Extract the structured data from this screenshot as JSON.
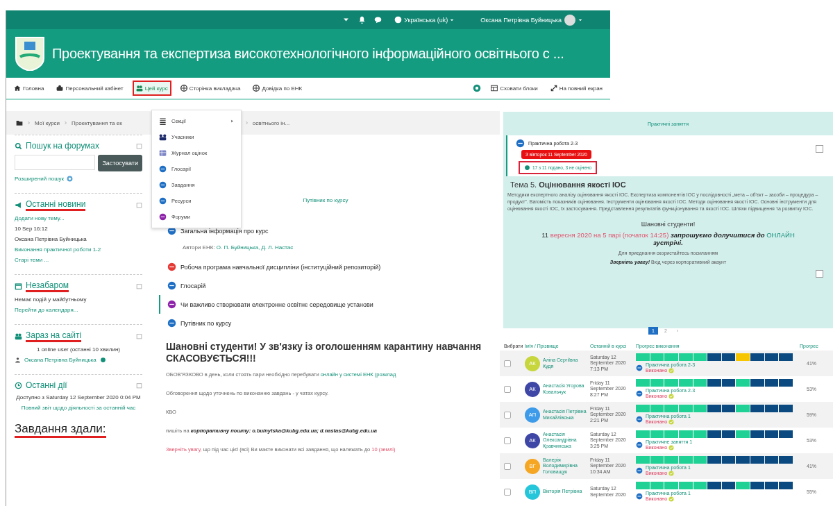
{
  "top_bar": {
    "language": "Українська (uk)",
    "user": "Оксана Петрівна Буйницька"
  },
  "header": {
    "title": "Проектування та експертиза високотехнологічного інформаційного освітнього с ..."
  },
  "nav": {
    "items": [
      {
        "label": "Головна",
        "highlighted": false
      },
      {
        "label": "Персональний кабінет",
        "highlighted": false
      },
      {
        "label": "Цей курс",
        "highlighted": true
      },
      {
        "label": "Сторінка викладача",
        "highlighted": false
      },
      {
        "label": "Довідка по ЕНК",
        "highlighted": false
      }
    ],
    "right": [
      {
        "label": "Сховати блоки"
      },
      {
        "label": "На повний екран"
      }
    ]
  },
  "breadcrumb": [
    "Мої курси",
    "Проектування та ек",
    "освітнього ін..."
  ],
  "dropdown": {
    "items": [
      {
        "kind": "list",
        "label": "Секції",
        "has_submenu": true
      },
      {
        "kind": "people",
        "label": "Учасники",
        "has_submenu": false
      },
      {
        "kind": "grades",
        "label": "Журнал оцінок",
        "has_submenu": false
      },
      {
        "kind": "activity",
        "label": "Глосарії",
        "color": "#1f6fc5",
        "has_submenu": false
      },
      {
        "kind": "activity",
        "label": "Завдання",
        "color": "#1f6fc5",
        "has_submenu": false
      },
      {
        "kind": "activity",
        "label": "Ресурси",
        "color": "#1f6fc5",
        "has_submenu": false
      },
      {
        "kind": "activity",
        "label": "Форуми",
        "color": "#8e24aa",
        "has_submenu": false
      }
    ]
  },
  "sidebar": {
    "blocks": [
      {
        "kind": "search",
        "title": "Пошук на форумах",
        "underlined": false,
        "button": "Застосувати",
        "link": "Розширений пошук"
      },
      {
        "kind": "list",
        "title": "Останні новини",
        "underlined": true,
        "lines": [
          {
            "text": "Додати нову тему...",
            "kind": "link"
          },
          {
            "text": "10 Sep 16:12",
            "kind": "text"
          },
          {
            "text": "Оксана Петрівна Буйницька",
            "kind": "text"
          },
          {
            "text": "Виконання практичної роботи 1-2",
            "kind": "link"
          },
          {
            "text": "Старі теми ...",
            "kind": "link"
          }
        ]
      },
      {
        "kind": "list",
        "title": "Незабаром",
        "underlined": true,
        "lines": [
          {
            "text": "Немає подій у майбутньому",
            "kind": "text"
          },
          {
            "text": "Перейти до календаря...",
            "kind": "link"
          }
        ]
      },
      {
        "kind": "list",
        "title": "Зараз на сайті",
        "underlined": true,
        "lines": [
          {
            "text": "1 online user (останні 10 хвилин)",
            "kind": "center"
          },
          {
            "text": "Оксана Петрівна Буйницька",
            "kind": "user"
          }
        ]
      },
      {
        "kind": "list",
        "title": "Останні дії",
        "underlined": false,
        "lines": [
          {
            "text": "Доступно з Saturday 12 September 2020 0:04 PM",
            "kind": "center"
          },
          {
            "text": "Повний звіт щодо діяльності за останній час",
            "kind": "centerlink"
          }
        ]
      }
    ],
    "note": {
      "text": "Завдання здали:",
      "underlined": true
    }
  },
  "course": {
    "guide_link": "Путівник по курсу",
    "items": [
      {
        "kind": "activity",
        "title": "Загальна інформація про курс",
        "color": "#1f6fc5",
        "current": false
      },
      {
        "kind": "note",
        "text": "Автори ЕНК:",
        "link": "О. П. Буйницька, Д. Л. Настас"
      },
      {
        "kind": "activity",
        "title": "Робоча програма навчальної дисципліни (інституційний репозиторій)",
        "color": "#e53935",
        "current": false
      },
      {
        "kind": "activity",
        "title": "Глосарій",
        "color": "#1f6fc5",
        "current": false
      },
      {
        "kind": "activity",
        "title": "Чи важливо створювати електронне освітнє середовище установи",
        "color": "#8e24aa",
        "current": true
      },
      {
        "kind": "activity",
        "title": "Путівник по курсу",
        "color": "#1f6fc5",
        "current": false
      }
    ],
    "announcement": {
      "heading": "Шановні студенти! У зв'язку із оголошенням карантину навчання СКАСОВУЄТЬСЯ!!!",
      "paragraphs": [
        [
          {
            "kind": "plain",
            "text": "ОБОВ'ЯЗКОВО в день, коли стоять пари необхідно перебувати"
          },
          {
            "kind": "link",
            "text": "онлайн у системі ЕНК (розклад"
          }
        ],
        [
          {
            "kind": "plain",
            "text": "Обговорення щодо уточнень по виконанню завдань - у чатах курсу."
          }
        ],
        [
          {
            "kind": "plain",
            "text": "КВО"
          }
        ],
        [
          {
            "kind": "plain",
            "text": "пишіть на"
          },
          {
            "kind": "bold",
            "text": "корпоративну пошту: o.buinytska@kubg.edu.ua; d.nastas@kubg.edu.ua"
          }
        ],
        [
          {
            "kind": "alert",
            "text": "Зверніть увагу,"
          },
          {
            "kind": "plain",
            "text": "що під час цієї (всі) Ви маєте виконати всі завдання, що належать до"
          },
          {
            "kind": "alert",
            "text": "10 (землі)"
          }
        ]
      ]
    }
  },
  "practice": {
    "section_title": "Практичні заняття",
    "activity": {
      "title": "Практична робота 2-3",
      "deadline": "З вівторок 11 September 2020",
      "submissions": "17 з 11 подано, 3 не оцінено",
      "highlighted": true,
      "completed": false
    },
    "notice_completed": false,
    "topic": {
      "label": "Тема 5.",
      "title": "Оцінювання якості ІОС"
    },
    "description": "Методики експертного аналізу оцінювання якості ІОС. Експертиза компонентів ІОС у послідовності „мета – об'єкт – засоби – процедура – продукт\". Вагомість показників оцінювання. Інструменти оцінювання якості ІОС. Методи оцінювання якості ІОС. Основні інструменти для оцінювання якості ІОС, їх застосування. Представлення результатів функціонування та якості ІОС. Шляхи підвищення та розвитку ІОС.",
    "greeting": "Шановні студенти!",
    "invite": [
      {
        "kind": "plain",
        "text": "11"
      },
      {
        "kind": "alert",
        "text": "вересня 2020 на 5 парі (початок 14:25)"
      },
      {
        "kind": "bold",
        "text": "запрошуємо долучитися до"
      },
      {
        "kind": "link",
        "text": "ОНЛАЙН"
      },
      {
        "kind": "bold",
        "text": "зустрічі."
      }
    ],
    "join": "Для приєднання скористайтесь посиланням",
    "warning": [
      {
        "kind": "bold",
        "text": "Зверніть увагу!"
      },
      {
        "kind": "plain",
        "text": "Вхід через корпоративний акаунт"
      }
    ],
    "pages": [
      {
        "label": "1",
        "selected": true
      },
      {
        "label": "2",
        "selected": false
      },
      {
        "label": "›",
        "selected": false
      }
    ]
  },
  "progress_table": {
    "columns": [
      "Вибрати",
      "Ім'я / Прізвище",
      "Останній в курсі",
      "Прогрес виконання",
      "Прогрес"
    ],
    "rows": [
      {
        "selected": false,
        "initials": "АК",
        "color": "#c6d63c",
        "name": "Аліна Сергіївна Кудя",
        "last": "Saturday 12 September 2020 7:13 PM",
        "segments": [
          {
            "complete": true,
            "pending": false
          },
          {
            "complete": true,
            "pending": false
          },
          {
            "complete": true,
            "pending": false
          },
          {
            "complete": true,
            "pending": false
          },
          {
            "complete": true,
            "pending": false
          },
          {
            "complete": false,
            "pending": false
          },
          {
            "complete": false,
            "pending": false
          },
          {
            "complete": false,
            "pending": true
          },
          {
            "complete": false,
            "pending": false
          },
          {
            "complete": false,
            "pending": false
          },
          {
            "complete": false,
            "pending": false
          }
        ],
        "activity": "Практична робота 2-3",
        "status": "Виконано",
        "percent": "41%"
      },
      {
        "selected": false,
        "initials": "АК",
        "color": "#3f47a6",
        "name": "Анастасія Угорова Ковальчук",
        "last": "Friday 11 September 2020 8:27 PM",
        "segments": [
          {
            "complete": true,
            "pending": false
          },
          {
            "complete": true,
            "pending": false
          },
          {
            "complete": true,
            "pending": false
          },
          {
            "complete": true,
            "pending": false
          },
          {
            "complete": true,
            "pending": false
          },
          {
            "complete": false,
            "pending": false
          },
          {
            "complete": false,
            "pending": false
          },
          {
            "complete": true,
            "pending": false
          },
          {
            "complete": false,
            "pending": false
          },
          {
            "complete": false,
            "pending": false
          },
          {
            "complete": false,
            "pending": false
          }
        ],
        "activity": "Практична робота 2-3",
        "status": "Виконано",
        "percent": "53%"
      },
      {
        "selected": false,
        "initials": "АП",
        "color": "#3d9be9",
        "name": "Анастасія Петрівна Михайлівська",
        "last": "Friday 11 September 2020 2:21 PM",
        "segments": [
          {
            "complete": true,
            "pending": false
          },
          {
            "complete": true,
            "pending": false
          },
          {
            "complete": true,
            "pending": false
          },
          {
            "complete": true,
            "pending": false
          },
          {
            "complete": true,
            "pending": false
          },
          {
            "complete": false,
            "pending": false
          },
          {
            "complete": false,
            "pending": false
          },
          {
            "complete": true,
            "pending": false
          },
          {
            "complete": false,
            "pending": false
          },
          {
            "complete": false,
            "pending": false
          },
          {
            "complete": false,
            "pending": false
          }
        ],
        "activity": "Практична робота 1",
        "status": "Виконано",
        "percent": "59%"
      },
      {
        "selected": false,
        "initials": "АК",
        "color": "#3f47a6",
        "name": "Анастасія Олександрівна Кравчинська",
        "last": "Saturday 12 September 2020 3:25 PM",
        "segments": [
          {
            "complete": true,
            "pending": false
          },
          {
            "complete": true,
            "pending": false
          },
          {
            "complete": true,
            "pending": false
          },
          {
            "complete": true,
            "pending": false
          },
          {
            "complete": true,
            "pending": false
          },
          {
            "complete": false,
            "pending": false
          },
          {
            "complete": false,
            "pending": false
          },
          {
            "complete": true,
            "pending": false
          },
          {
            "complete": false,
            "pending": false
          },
          {
            "complete": false,
            "pending": false
          },
          {
            "complete": false,
            "pending": false
          }
        ],
        "activity": "Практичне заняття 1",
        "status": "Виконано",
        "percent": "53%"
      },
      {
        "selected": false,
        "initials": "ВГ",
        "color": "#f5a623",
        "name": "Валерія Володимирівна Головащук",
        "last": "Friday 11 September 2020 10:34 AM",
        "segments": [
          {
            "complete": true,
            "pending": false
          },
          {
            "complete": true,
            "pending": false
          },
          {
            "complete": true,
            "pending": false
          },
          {
            "complete": true,
            "pending": false
          },
          {
            "complete": true,
            "pending": false
          },
          {
            "complete": false,
            "pending": false
          },
          {
            "complete": false,
            "pending": false
          },
          {
            "complete": false,
            "pending": false
          },
          {
            "complete": false,
            "pending": false
          },
          {
            "complete": false,
            "pending": false
          },
          {
            "complete": false,
            "pending": false
          }
        ],
        "activity": "Практична робота 1",
        "status": "Виконано",
        "percent": "41%"
      },
      {
        "selected": false,
        "initials": "ВП",
        "color": "#26c6da",
        "name": "Вікторія Петрівна",
        "last": "Saturday 12 September 2020",
        "segments": [
          {
            "complete": true,
            "pending": false
          },
          {
            "complete": true,
            "pending": false
          },
          {
            "complete": true,
            "pending": false
          },
          {
            "complete": true,
            "pending": false
          },
          {
            "complete": true,
            "pending": false
          },
          {
            "complete": false,
            "pending": false
          },
          {
            "complete": false,
            "pending": false
          },
          {
            "complete": true,
            "pending": false
          },
          {
            "complete": false,
            "pending": false
          },
          {
            "complete": false,
            "pending": false
          },
          {
            "complete": false,
            "pending": false
          }
        ],
        "activity": "Практична робота 1",
        "status": "Виконано",
        "percent": "55%"
      }
    ]
  }
}
